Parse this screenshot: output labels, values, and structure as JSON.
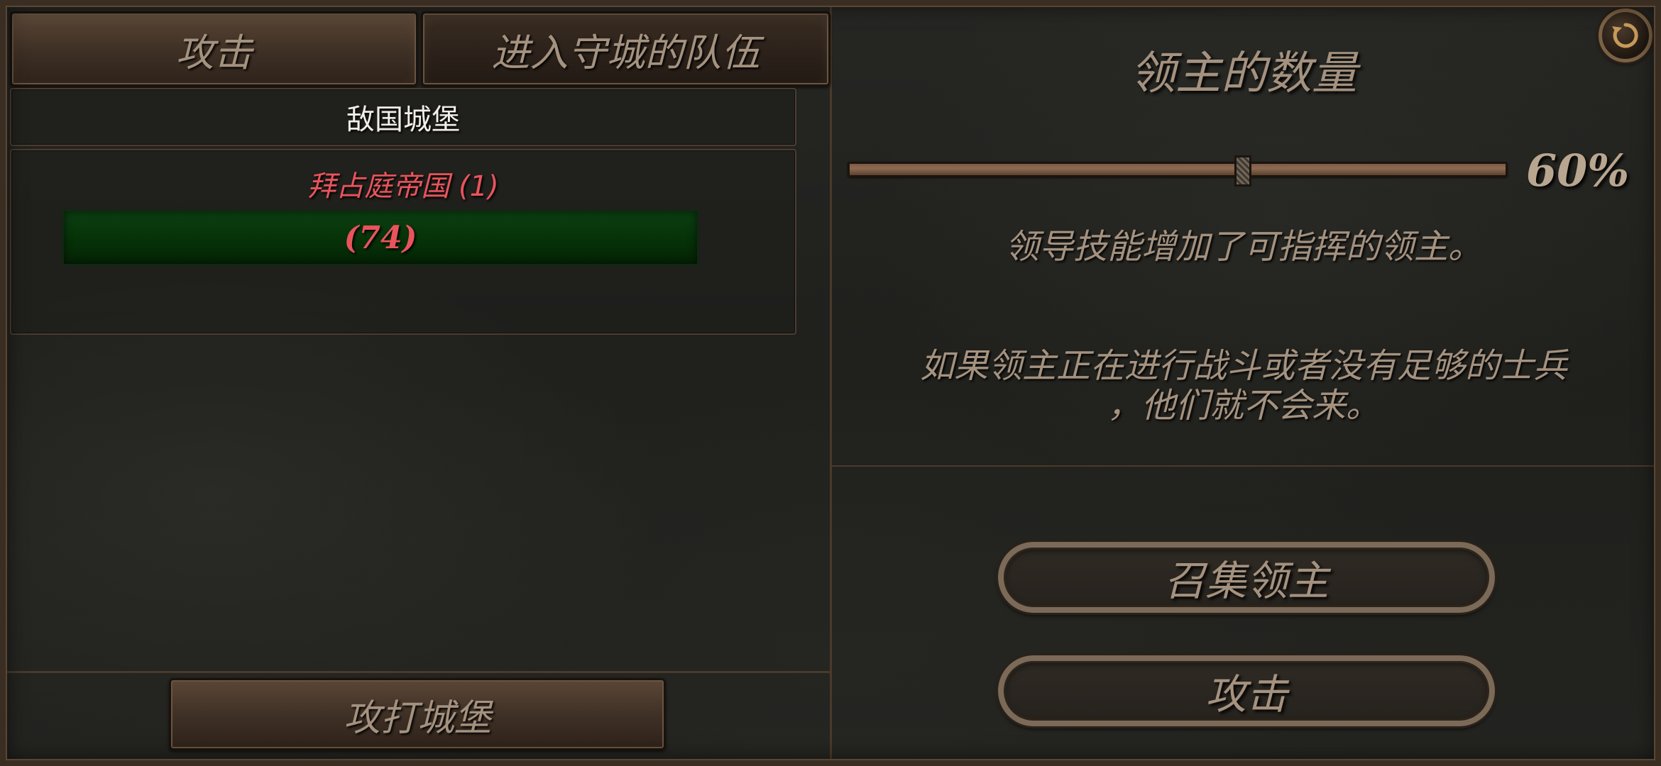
{
  "left": {
    "tabs": [
      {
        "label": "攻击"
      },
      {
        "label": "进入守城的队伍"
      }
    ],
    "enemy_header": "敌国城堡",
    "faction": {
      "name": "拜占庭帝国 (1)",
      "troops": "(74)"
    },
    "attack_castle_label": "攻打城堡"
  },
  "right": {
    "title": "领主的数量",
    "slider": {
      "value_percent": 60,
      "label": "60%"
    },
    "leadership_text": "领导技能增加了可指挥的领主。",
    "warning_text": "如果领主正在进行战斗或者没有足够的士兵，他们就不会来。",
    "warning_lines": [
      "如果领主正在进行战斗或者没有足够的士兵",
      "，他们就不会来。"
    ],
    "summon_lords_label": "召集领主",
    "attack_label": "攻击"
  },
  "icons": {
    "refresh": "refresh-icon"
  },
  "colors": {
    "faction_red": "#e8545c",
    "troop_bar_green": "#063208",
    "text_muted": "#a4927f"
  }
}
